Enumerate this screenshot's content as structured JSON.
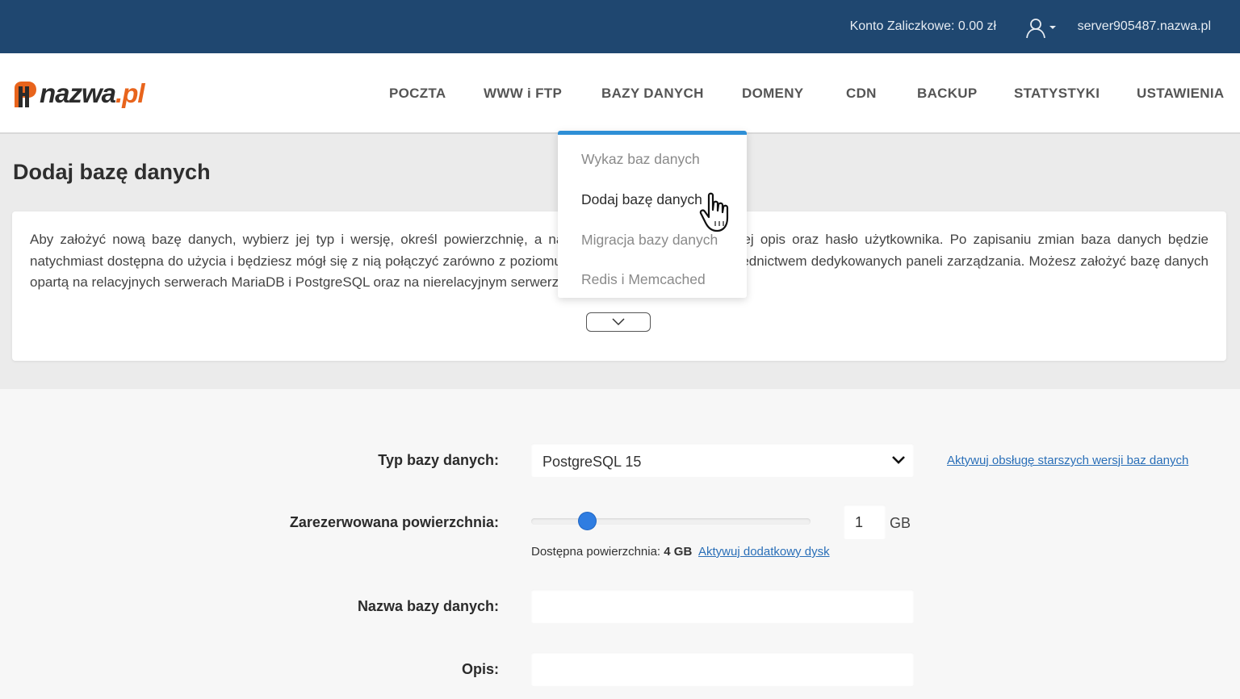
{
  "topbar": {
    "balance": "Konto Zaliczkowe: 0.00 zł",
    "server": "server905487.nazwa.pl"
  },
  "logo": {
    "name": "nazwa",
    "tld": ".pl"
  },
  "nav": {
    "items": [
      "POCZTA",
      "WWW i FTP",
      "BAZY DANYCH",
      "DOMENY",
      "CDN",
      "BACKUP",
      "STATYSTYKI",
      "USTAWIENIA"
    ]
  },
  "dropdown": {
    "items": [
      "Wykaz baz danych",
      "Dodaj bazę danych",
      "Migracja bazy danych",
      "Redis i Memcached"
    ],
    "accent": "#2e8fd6"
  },
  "page": {
    "title": "Dodaj bazę danych",
    "info": "Aby założyć nową bazę danych, wybierz jej typ i wersję, określ powierzchnię, a następnie wpisz nazwę bazy, jej opis oraz hasło użytkownika. Po zapisaniu zmian baza danych będzie natychmiast dostępna do użycia i będziesz mógł się z nią połączyć zarówno z poziomu aplikacji, jak również za pośrednictwem dedykowanych paneli zarządzania. Możesz założyć bazę danych opartą na relacyjnych serwerach MariaDB i PostgreSQL oraz na nierelacyjnym serwerze MongoDB."
  },
  "form": {
    "db_type_label": "Typ bazy danych:",
    "db_type_value": "PostgreSQL 15",
    "legacy_link": "Aktywuj obsługę starszych wersji baz danych",
    "size_label": "Zarezerwowana powierzchnia:",
    "size_value": "1",
    "size_unit": "GB",
    "size_slider_fraction": 0.2,
    "available_label": "Dostępna powierzchnia:",
    "available_value": "4 GB",
    "disk_link": "Aktywuj dodatkowy dysk",
    "name_label": "Nazwa bazy danych:",
    "name_value": "",
    "desc_label": "Opis:",
    "desc_value": ""
  },
  "colors": {
    "topbar": "#1f4770",
    "logo_orange": "#e8641c",
    "slider": "#2f7de1",
    "link": "#2a6fb8"
  }
}
